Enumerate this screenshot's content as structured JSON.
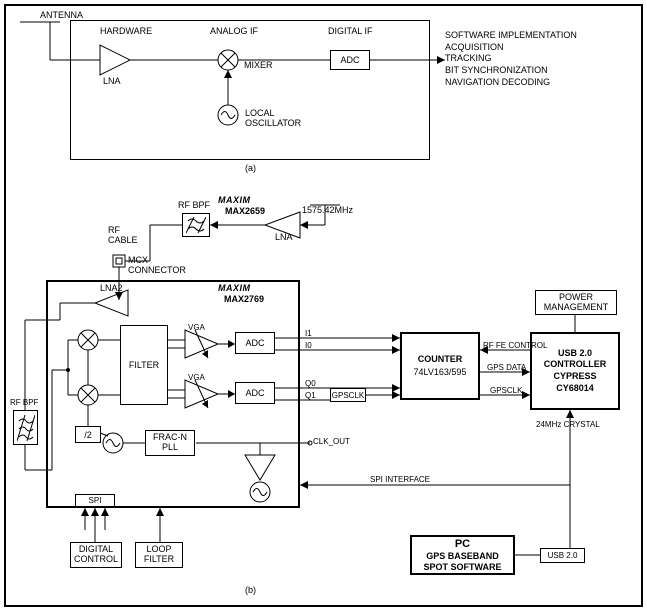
{
  "diagram_a": {
    "antenna": "ANTENNA",
    "hardware": "HARDWARE",
    "lna": "LNA",
    "analog_if": "ANALOG IF",
    "mixer": "MIXER",
    "local_osc": "LOCAL\nOSCILLATOR",
    "digital_if": "DIGITAL IF",
    "adc": "ADC",
    "outputs": "SOFTWARE IMPLEMENTATION\nACQUISITION\nTRACKING\nBIT SYNCHRONIZATION\nNAVIGATION DECODING",
    "caption": "(a)"
  },
  "diagram_b": {
    "brand1": "MAXIM",
    "part1": "MAX2659",
    "freq": "1575.42MHz",
    "lna": "LNA",
    "rf_bpf": "RF BPF",
    "rf_cable": "RF\nCABLE",
    "mcx": "MCX\nCONNECTOR",
    "brand2": "MAXIM",
    "part2": "MAX2769",
    "lna2": "LNA2",
    "filter": "FILTER",
    "vga": "VGA",
    "adc": "ADC",
    "div2": "/2",
    "fracn": "FRAC-N\nPLL",
    "i1": "I1",
    "i0": "I0",
    "q0": "Q0",
    "q1": "Q1",
    "gpsclk": "GPSCLK",
    "clkout": "CLK_OUT",
    "rf_bpf2": "RF BPF",
    "spi": "SPI",
    "digital_ctrl": "DIGITAL\nCONTROL",
    "loop_filter": "LOOP\nFILTER",
    "counter_title": "COUNTER",
    "counter_part": "74LV163/595",
    "power_mgmt": "POWER\nMANAGEMENT",
    "usb_ctrl": "USB 2.0\nCONTROLLER\nCYPRESS\nCY68014",
    "rf_fe": "RF FE CONTROL",
    "gps_data": "GPS DATA",
    "gpsclk2": "GPSCLK",
    "crystal": "24MHz CRYSTAL",
    "spi_if": "SPI INTERFACE",
    "pc_title": "PC",
    "pc_sub": "GPS BASEBAND\nSPOT SOFTWARE",
    "usb2": "USB 2.0",
    "caption": "(b)"
  }
}
